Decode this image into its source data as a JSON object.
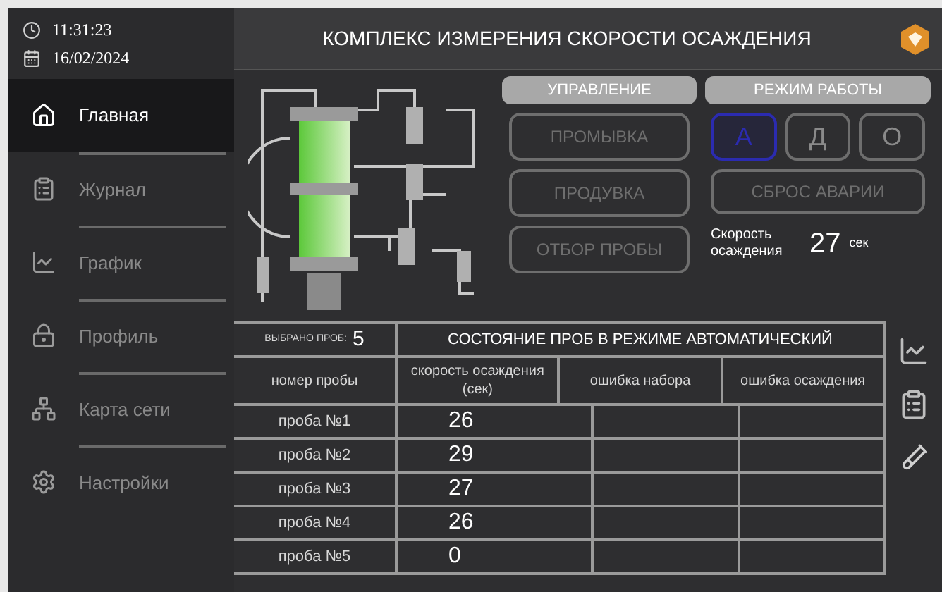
{
  "clock": {
    "time": "11:31:23",
    "date": "16/02/2024"
  },
  "sidebar": {
    "items": [
      {
        "label": "Главная",
        "selected": true
      },
      {
        "label": "Журнал",
        "selected": false
      },
      {
        "label": "График",
        "selected": false
      },
      {
        "label": "Профиль",
        "selected": false
      },
      {
        "label": "Карта сети",
        "selected": false
      },
      {
        "label": "Настройки",
        "selected": false
      }
    ]
  },
  "header": {
    "title": "КОМПЛЕКС ИЗМЕРЕНИЯ СКОРОСТИ ОСАЖДЕНИЯ"
  },
  "control": {
    "title": "УПРАВЛЕНИЕ",
    "buttons": [
      "ПРОМЫВКА",
      "ПРОДУВКА",
      "ОТБОР ПРОБЫ"
    ]
  },
  "mode": {
    "title": "РЕЖИМ РАБОТЫ",
    "options": [
      {
        "label": "А",
        "selected": true
      },
      {
        "label": "Д",
        "selected": false
      },
      {
        "label": "О",
        "selected": false
      }
    ],
    "reset_button": "СБРОС АВАРИИ"
  },
  "speed": {
    "label": "Скорость осаждения",
    "value": "27",
    "unit": "сек"
  },
  "table": {
    "selected_label": "ВЫБРАНО ПРОБ:",
    "selected_count": "5",
    "title": "СОСТОЯНИЕ ПРОБ В РЕЖИМЕ АВТОМАТИЧЕСКИЙ",
    "columns": [
      "номер пробы",
      "скорость осаждения (сек)",
      "ошибка набора",
      "ошибка осаждения"
    ],
    "rows": [
      {
        "sample": "проба №1",
        "speed": "26"
      },
      {
        "sample": "проба №2",
        "speed": "29"
      },
      {
        "sample": "проба №3",
        "speed": "27"
      },
      {
        "sample": "проба №4",
        "speed": "26"
      },
      {
        "sample": "проба №5",
        "speed": "0"
      }
    ]
  }
}
